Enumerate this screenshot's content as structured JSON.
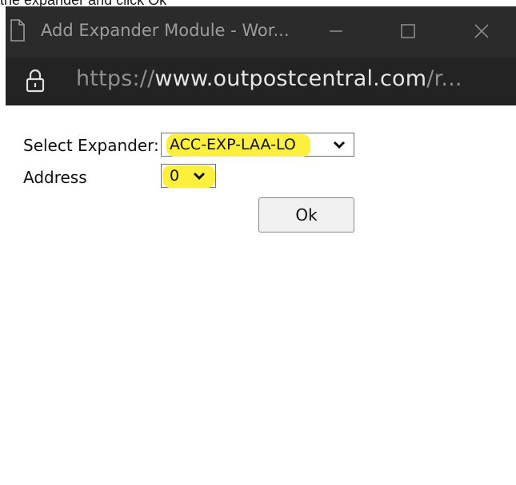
{
  "caption": {
    "text": "the expander and click Ok"
  },
  "window": {
    "title": "Add Expander Module - Wor...",
    "controls": {
      "minimize_icon": "minimize-icon",
      "maximize_icon": "maximize-icon",
      "close_icon": "close-icon"
    },
    "colors": {
      "titlebar_bg": "#2b2b2b",
      "addressbar_bg": "#232323"
    }
  },
  "address_bar": {
    "lock_icon": "lock-icon",
    "scheme": "https://",
    "host": "www.outpostcentral.com",
    "rest": "/r..."
  },
  "form": {
    "expander": {
      "label": "Select Expander:",
      "selected": "ACC-EXP-LAA-LO"
    },
    "address": {
      "label": "Address",
      "selected": "0"
    },
    "ok_label": "Ok",
    "highlight_color": "#fdf03c"
  }
}
